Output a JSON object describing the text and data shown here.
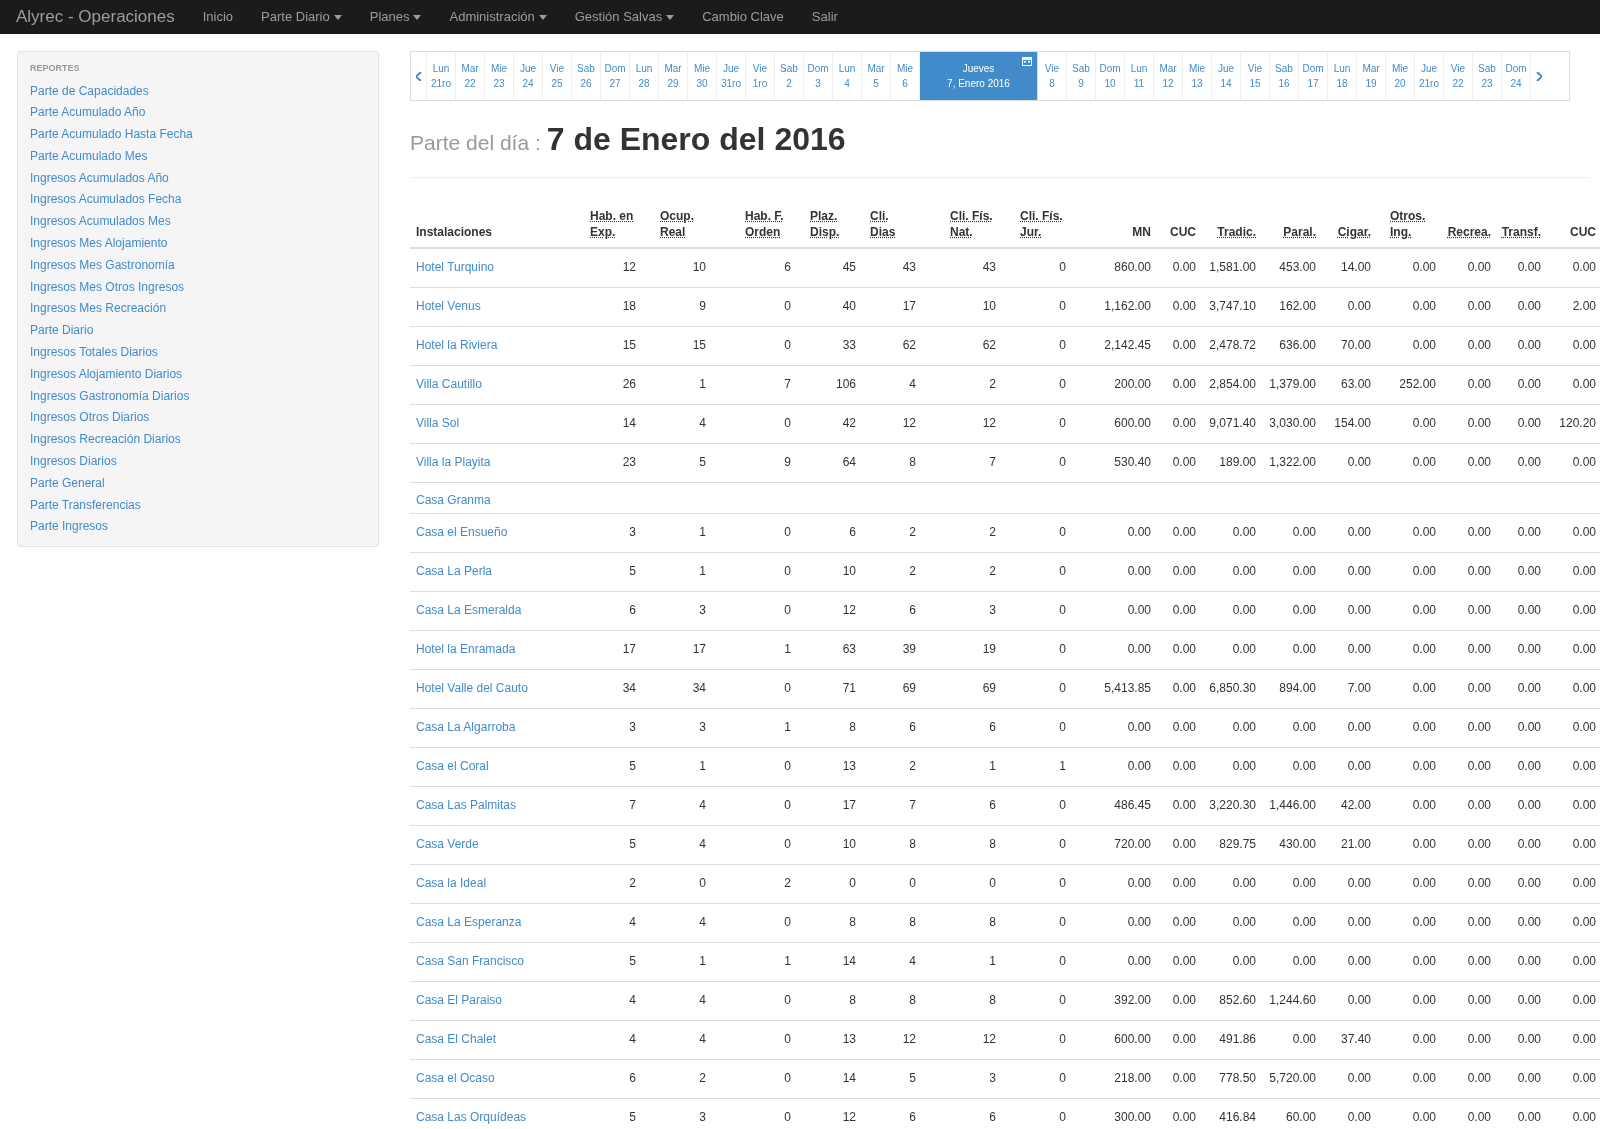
{
  "navbar": {
    "brand": "Alyrec - Operaciones",
    "items": [
      {
        "label": "Inicio",
        "kind": "link"
      },
      {
        "label": "Parte Diario",
        "kind": "dropdown"
      },
      {
        "label": "Planes",
        "kind": "dropdown"
      },
      {
        "label": "Administración",
        "kind": "dropdown"
      },
      {
        "label": "Gestión Salvas",
        "kind": "dropdown"
      },
      {
        "label": "Cambio Clave",
        "kind": "link"
      },
      {
        "label": "Salir",
        "kind": "link"
      }
    ]
  },
  "sidebar": {
    "heading": "REPORTES",
    "items": [
      "Parte de Capacidades",
      "Parte Acumulado Año",
      "Parte Acumulado Hasta Fecha",
      "Parte Acumulado Mes",
      "Ingresos Acumulados Año",
      "Ingresos Acumulados Fecha",
      "Ingresos Acumulados Mes",
      "Ingresos Mes Alojamiento",
      "Ingresos Mes Gastronomía",
      "Ingresos Mes Otros Ingresos",
      "Ingresos Mes Recreación",
      "Parte Diario",
      "Ingresos Totales Diarios",
      "Ingresos Alojamiento Diarios",
      "Ingresos Gastronomía Diarios",
      "Ingresos Otros Diarios",
      "Ingresos Recreación Diarios",
      "Ingresos Diarios",
      "Parte General",
      "Parte Transferencias",
      "Parte Ingresos"
    ]
  },
  "date_strip": {
    "days": [
      {
        "day": "Lun",
        "date": "21ro",
        "selected": false
      },
      {
        "day": "Mar",
        "date": "22",
        "selected": false
      },
      {
        "day": "Mie",
        "date": "23",
        "selected": false
      },
      {
        "day": "Jue",
        "date": "24",
        "selected": false
      },
      {
        "day": "Vie",
        "date": "25",
        "selected": false
      },
      {
        "day": "Sab",
        "date": "26",
        "selected": false
      },
      {
        "day": "Dom",
        "date": "27",
        "selected": false
      },
      {
        "day": "Lun",
        "date": "28",
        "selected": false
      },
      {
        "day": "Mar",
        "date": "29",
        "selected": false
      },
      {
        "day": "Mie",
        "date": "30",
        "selected": false
      },
      {
        "day": "Jue",
        "date": "31ro",
        "selected": false
      },
      {
        "day": "Vie",
        "date": "1ro",
        "selected": false
      },
      {
        "day": "Sab",
        "date": "2",
        "selected": false
      },
      {
        "day": "Dom",
        "date": "3",
        "selected": false
      },
      {
        "day": "Lun",
        "date": "4",
        "selected": false
      },
      {
        "day": "Mar",
        "date": "5",
        "selected": false
      },
      {
        "day": "Mie",
        "date": "6",
        "selected": false
      },
      {
        "day": "Jueves",
        "date": "7, Enero 2016",
        "selected": true
      },
      {
        "day": "Vie",
        "date": "8",
        "selected": false
      },
      {
        "day": "Sab",
        "date": "9",
        "selected": false
      },
      {
        "day": "Dom",
        "date": "10",
        "selected": false
      },
      {
        "day": "Lun",
        "date": "11",
        "selected": false
      },
      {
        "day": "Mar",
        "date": "12",
        "selected": false
      },
      {
        "day": "Mie",
        "date": "13",
        "selected": false
      },
      {
        "day": "Jue",
        "date": "14",
        "selected": false
      },
      {
        "day": "Vie",
        "date": "15",
        "selected": false
      },
      {
        "day": "Sab",
        "date": "16",
        "selected": false
      },
      {
        "day": "Dom",
        "date": "17",
        "selected": false
      },
      {
        "day": "Lun",
        "date": "18",
        "selected": false
      },
      {
        "day": "Mar",
        "date": "19",
        "selected": false
      },
      {
        "day": "Mie",
        "date": "20",
        "selected": false
      },
      {
        "day": "Jue",
        "date": "21ro",
        "selected": false
      },
      {
        "day": "Vie",
        "date": "22",
        "selected": false
      },
      {
        "day": "Sab",
        "date": "23",
        "selected": false
      },
      {
        "day": "Dom",
        "date": "24",
        "selected": false
      }
    ]
  },
  "page_title": {
    "label": "Parte del día :",
    "date": "7 de Enero del 2016"
  },
  "table": {
    "columns": [
      {
        "label": "Instalaciones",
        "abbr": false
      },
      {
        "label": "Hab. en Exp.",
        "abbr": true
      },
      {
        "label": "Ocup. Real",
        "abbr": true
      },
      {
        "label": "Hab. F. Orden",
        "abbr": true
      },
      {
        "label": "Plaz. Disp.",
        "abbr": true
      },
      {
        "label": "Cli. Dias",
        "abbr": true
      },
      {
        "label": "Cli. Fís. Nat.",
        "abbr": true
      },
      {
        "label": "Cli. Fís. Jur.",
        "abbr": true
      },
      {
        "label": "MN",
        "abbr": false
      },
      {
        "label": "CUC",
        "abbr": false
      },
      {
        "label": "Tradic.",
        "abbr": true
      },
      {
        "label": "Paral.",
        "abbr": true
      },
      {
        "label": "Cigar.",
        "abbr": true
      },
      {
        "label": "Otros. Ing.",
        "abbr": true
      },
      {
        "label": "Recrea.",
        "abbr": true
      },
      {
        "label": "Transf.",
        "abbr": true
      },
      {
        "label": "CUC",
        "abbr": false
      }
    ],
    "rows": [
      {
        "kind": "data",
        "name": "Hotel Turquino",
        "cells": [
          "12",
          "10",
          "6",
          "45",
          "43",
          "43",
          "0",
          "860.00",
          "0.00",
          "1,581.00",
          "453.00",
          "14.00",
          "0.00",
          "0.00",
          "0.00",
          "0.00"
        ]
      },
      {
        "kind": "data",
        "name": "Hotel Venus",
        "cells": [
          "18",
          "9",
          "0",
          "40",
          "17",
          "10",
          "0",
          "1,162.00",
          "0.00",
          "3,747.10",
          "162.00",
          "0.00",
          "0.00",
          "0.00",
          "0.00",
          "2.00"
        ]
      },
      {
        "kind": "data",
        "name": "Hotel la Riviera",
        "cells": [
          "15",
          "15",
          "0",
          "33",
          "62",
          "62",
          "0",
          "2,142.45",
          "0.00",
          "2,478.72",
          "636.00",
          "70.00",
          "0.00",
          "0.00",
          "0.00",
          "0.00"
        ]
      },
      {
        "kind": "data",
        "name": "Villa Cautillo",
        "cells": [
          "26",
          "1",
          "7",
          "106",
          "4",
          "2",
          "0",
          "200.00",
          "0.00",
          "2,854.00",
          "1,379.00",
          "63.00",
          "252.00",
          "0.00",
          "0.00",
          "0.00"
        ]
      },
      {
        "kind": "data",
        "name": "Villa Sol",
        "cells": [
          "14",
          "4",
          "0",
          "42",
          "12",
          "12",
          "0",
          "600.00",
          "0.00",
          "9,071.40",
          "3,030.00",
          "154.00",
          "0.00",
          "0.00",
          "0.00",
          "120.20"
        ]
      },
      {
        "kind": "data",
        "name": "Villa la Playita",
        "cells": [
          "23",
          "5",
          "9",
          "64",
          "8",
          "7",
          "0",
          "530.40",
          "0.00",
          "189.00",
          "1,322.00",
          "0.00",
          "0.00",
          "0.00",
          "0.00",
          "0.00"
        ]
      },
      {
        "kind": "group",
        "name": "Casa Granma"
      },
      {
        "kind": "data",
        "name": "Casa el Ensueño",
        "cells": [
          "3",
          "1",
          "0",
          "6",
          "2",
          "2",
          "0",
          "0.00",
          "0.00",
          "0.00",
          "0.00",
          "0.00",
          "0.00",
          "0.00",
          "0.00",
          "0.00"
        ]
      },
      {
        "kind": "data",
        "name": "Casa La Perla",
        "cells": [
          "5",
          "1",
          "0",
          "10",
          "2",
          "2",
          "0",
          "0.00",
          "0.00",
          "0.00",
          "0.00",
          "0.00",
          "0.00",
          "0.00",
          "0.00",
          "0.00"
        ]
      },
      {
        "kind": "data",
        "name": "Casa La Esmeralda",
        "cells": [
          "6",
          "3",
          "0",
          "12",
          "6",
          "3",
          "0",
          "0.00",
          "0.00",
          "0.00",
          "0.00",
          "0.00",
          "0.00",
          "0.00",
          "0.00",
          "0.00"
        ]
      },
      {
        "kind": "data",
        "name": "Hotel la Enramada",
        "cells": [
          "17",
          "17",
          "1",
          "63",
          "39",
          "19",
          "0",
          "0.00",
          "0.00",
          "0.00",
          "0.00",
          "0.00",
          "0.00",
          "0.00",
          "0.00",
          "0.00"
        ]
      },
      {
        "kind": "data",
        "name": "Hotel Valle del Cauto",
        "cells": [
          "34",
          "34",
          "0",
          "71",
          "69",
          "69",
          "0",
          "5,413.85",
          "0.00",
          "6,850.30",
          "894.00",
          "7.00",
          "0.00",
          "0.00",
          "0.00",
          "0.00"
        ]
      },
      {
        "kind": "data",
        "name": "Casa La Algarroba",
        "cells": [
          "3",
          "3",
          "1",
          "8",
          "6",
          "6",
          "0",
          "0.00",
          "0.00",
          "0.00",
          "0.00",
          "0.00",
          "0.00",
          "0.00",
          "0.00",
          "0.00"
        ]
      },
      {
        "kind": "data",
        "name": "Casa el Coral",
        "cells": [
          "5",
          "1",
          "0",
          "13",
          "2",
          "1",
          "1",
          "0.00",
          "0.00",
          "0.00",
          "0.00",
          "0.00",
          "0.00",
          "0.00",
          "0.00",
          "0.00"
        ]
      },
      {
        "kind": "data",
        "name": "Casa Las Palmitas",
        "cells": [
          "7",
          "4",
          "0",
          "17",
          "7",
          "6",
          "0",
          "486.45",
          "0.00",
          "3,220.30",
          "1,446.00",
          "42.00",
          "0.00",
          "0.00",
          "0.00",
          "0.00"
        ]
      },
      {
        "kind": "data",
        "name": "Casa Verde",
        "cells": [
          "5",
          "4",
          "0",
          "10",
          "8",
          "8",
          "0",
          "720.00",
          "0.00",
          "829.75",
          "430.00",
          "21.00",
          "0.00",
          "0.00",
          "0.00",
          "0.00"
        ]
      },
      {
        "kind": "data",
        "name": "Casa la Ideal",
        "cells": [
          "2",
          "0",
          "2",
          "0",
          "0",
          "0",
          "0",
          "0.00",
          "0.00",
          "0.00",
          "0.00",
          "0.00",
          "0.00",
          "0.00",
          "0.00",
          "0.00"
        ]
      },
      {
        "kind": "data",
        "name": "Casa La Esperanza",
        "cells": [
          "4",
          "4",
          "0",
          "8",
          "8",
          "8",
          "0",
          "0.00",
          "0.00",
          "0.00",
          "0.00",
          "0.00",
          "0.00",
          "0.00",
          "0.00",
          "0.00"
        ]
      },
      {
        "kind": "data",
        "name": "Casa San Francisco",
        "cells": [
          "5",
          "1",
          "1",
          "14",
          "4",
          "1",
          "0",
          "0.00",
          "0.00",
          "0.00",
          "0.00",
          "0.00",
          "0.00",
          "0.00",
          "0.00",
          "0.00"
        ]
      },
      {
        "kind": "data",
        "name": "Casa El Paraiso",
        "cells": [
          "4",
          "4",
          "0",
          "8",
          "8",
          "8",
          "0",
          "392.00",
          "0.00",
          "852.60",
          "1,244.60",
          "0.00",
          "0.00",
          "0.00",
          "0.00",
          "0.00"
        ]
      },
      {
        "kind": "data",
        "name": "Casa El Chalet",
        "cells": [
          "4",
          "4",
          "0",
          "13",
          "12",
          "12",
          "0",
          "600.00",
          "0.00",
          "491.86",
          "0.00",
          "37.40",
          "0.00",
          "0.00",
          "0.00",
          "0.00"
        ]
      },
      {
        "kind": "data",
        "name": "Casa el Ocaso",
        "cells": [
          "6",
          "2",
          "0",
          "14",
          "5",
          "3",
          "0",
          "218.00",
          "0.00",
          "778.50",
          "5,720.00",
          "0.00",
          "0.00",
          "0.00",
          "0.00",
          "0.00"
        ]
      },
      {
        "kind": "data",
        "name": "Casa Las Orquídeas",
        "cells": [
          "5",
          "3",
          "0",
          "12",
          "6",
          "6",
          "0",
          "300.00",
          "0.00",
          "416.84",
          "60.00",
          "0.00",
          "0.00",
          "0.00",
          "0.00",
          "0.00"
        ]
      }
    ]
  }
}
